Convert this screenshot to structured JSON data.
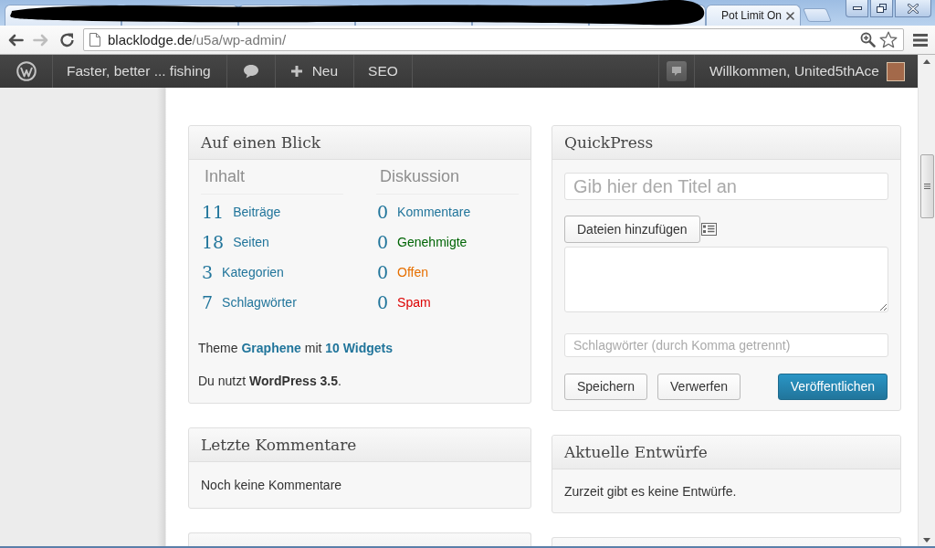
{
  "browser": {
    "tabs": [
      {
        "kind": "redacted"
      },
      {
        "kind": "redacted"
      },
      {
        "kind": "redacted"
      },
      {
        "kind": "redacted"
      },
      {
        "kind": "redacted"
      },
      {
        "kind": "redacted"
      },
      {
        "kind": "page",
        "label": "Pot Limit On"
      }
    ],
    "back": {
      "disabled": false
    },
    "forward": {
      "disabled": true
    },
    "address": {
      "host": "blacklodge.de",
      "path": "/u5a/wp-admin/"
    }
  },
  "admin_bar": {
    "left": [
      {
        "kind": "logo"
      },
      {
        "kind": "site",
        "label": "Faster, better ... fishing"
      },
      {
        "kind": "comments"
      },
      {
        "kind": "new",
        "label": "Neu"
      },
      {
        "kind": "menu",
        "label": "SEO"
      }
    ],
    "right": [
      {
        "kind": "notice"
      },
      {
        "kind": "account",
        "label": "Willkommen, United5thAce"
      }
    ]
  },
  "glance": {
    "title": "Auf einen Blick",
    "columns": [
      {
        "heading": "Inhalt",
        "rows": [
          {
            "count": "11",
            "label": "Beiträge"
          },
          {
            "count": "18",
            "label": "Seiten"
          },
          {
            "count": "3",
            "label": "Kategorien"
          },
          {
            "count": "7",
            "label": "Schlagwörter"
          }
        ]
      },
      {
        "heading": "Diskussion",
        "rows": [
          {
            "count": "0",
            "label": "Kommentare",
            "color": "#21759b"
          },
          {
            "count": "0",
            "label": "Genehmigte",
            "color": "#006505"
          },
          {
            "count": "0",
            "label": "Offen",
            "color": "#e66f00"
          },
          {
            "count": "0",
            "label": "Spam",
            "color": "#dd0000"
          }
        ]
      }
    ],
    "theme_line": [
      {
        "kind": "text",
        "text": "Theme"
      },
      {
        "kind": "link",
        "text": "Graphene"
      },
      {
        "kind": "text",
        "text": "mit"
      },
      {
        "kind": "link",
        "text": "10 Widgets"
      }
    ],
    "version_line": "Du nutzt **WordPress 3.5**."
  },
  "recent_comments": {
    "title": "Letzte Kommentare",
    "text": "Noch keine Kommentare"
  },
  "quickpress": {
    "title": "QuickPress",
    "title_field": {
      "placeholder": "Gib hier den Titel an"
    },
    "media_button": "Dateien hinzufügen",
    "tags_field": {
      "placeholder": "Schlagwörter (durch Komma getrennt)"
    },
    "buttons": [
      {
        "label": "Speichern",
        "kind": "secondary"
      },
      {
        "label": "Verwerfen",
        "kind": "secondary"
      },
      {
        "label": "Veröffentlichen",
        "kind": "primary"
      }
    ]
  },
  "drafts": {
    "title": "Aktuelle Entwürfe",
    "text": "Zurzeit gibt es keine Entwürfe."
  }
}
